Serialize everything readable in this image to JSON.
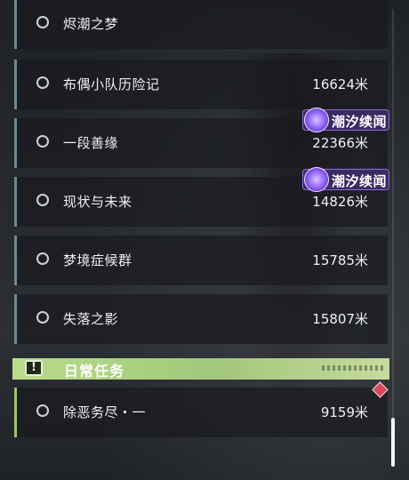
{
  "tasks": [
    {
      "name": "烬潮之梦",
      "distance": ""
    },
    {
      "name": "布偶小队历险记",
      "distance": "16624米"
    },
    {
      "name": "一段善缘",
      "distance": "22366米",
      "badge": "潮汐续闻"
    },
    {
      "name": "现状与未来",
      "distance": "14826米",
      "badge": "潮汐续闻"
    },
    {
      "name": "梦境症候群",
      "distance": "15785米"
    },
    {
      "name": "失落之影",
      "distance": "15807米"
    }
  ],
  "daily": {
    "header": "日常任务",
    "tasks": [
      {
        "name": "除恶务尽・一",
        "distance": "9159米"
      }
    ]
  },
  "icons": {
    "task_status": "circle-outline-icon",
    "badge": "tide-sequel-icon",
    "daily_header": "exclamation-icon",
    "tracked": "red-diamond-icon"
  },
  "colors": {
    "badge_bg": "#3a2a63",
    "badge_border": "#8e6ad4",
    "daily_header": "#b8dc8c",
    "quest_accent": "#6f8796",
    "daily_accent": "#9cc36e",
    "tracked_marker": "#d44a5a"
  }
}
